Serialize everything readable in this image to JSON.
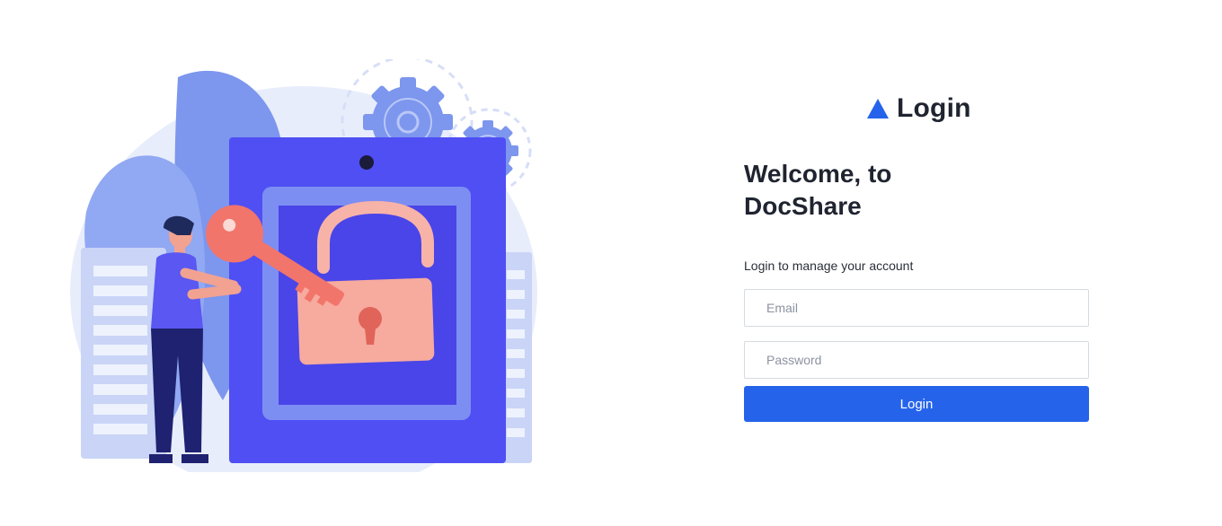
{
  "brand": {
    "icon": "triangle-logo-icon",
    "title": "Login",
    "accent_color": "#2563eb"
  },
  "welcome": {
    "line1": "Welcome, to",
    "line2": "DocShare"
  },
  "subtitle": "Login to manage your account",
  "form": {
    "email_placeholder": "Email",
    "password_placeholder": "Password",
    "login_button_label": "Login"
  },
  "illustration": {
    "icon": "security-unlock-illustration"
  }
}
